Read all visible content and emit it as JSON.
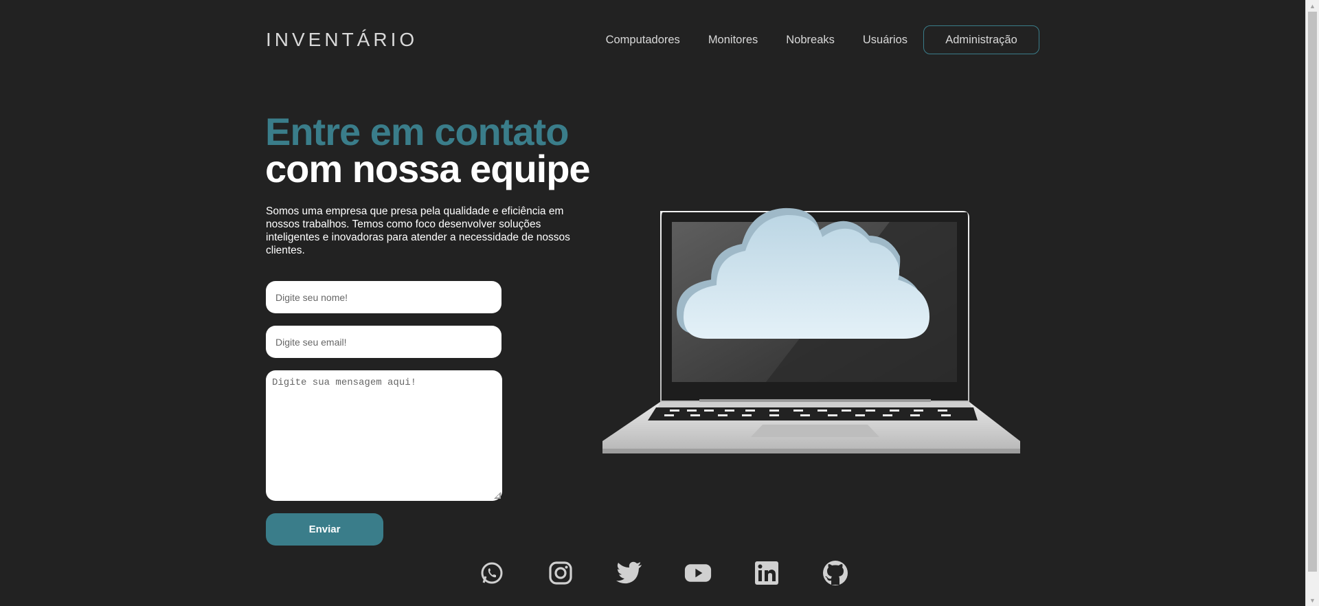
{
  "header": {
    "logo": "INVENTÁRIO",
    "nav": [
      {
        "label": "Computadores"
      },
      {
        "label": "Monitores"
      },
      {
        "label": "Nobreaks"
      },
      {
        "label": "Usuários"
      }
    ],
    "admin_label": "Administração"
  },
  "hero": {
    "headline_accent": "Entre em contato",
    "headline_main": "com nossa equipe",
    "description": "Somos uma empresa que presa pela qualidade e eficiência em nossos trabalhos. Temos como foco desenvolver soluções inteligentes e inovadoras para atender a necessidade de nossos clientes."
  },
  "form": {
    "name_placeholder": "Digite seu nome!",
    "email_placeholder": "Digite seu email!",
    "message_placeholder": "Digite sua mensagem aqui!",
    "submit_label": "Enviar"
  },
  "social": [
    "whatsapp-icon",
    "instagram-icon",
    "twitter-icon",
    "youtube-icon",
    "linkedin-icon",
    "github-icon"
  ],
  "colors": {
    "background": "#222222",
    "accent": "#3a7d8a",
    "text": "#ffffff"
  }
}
